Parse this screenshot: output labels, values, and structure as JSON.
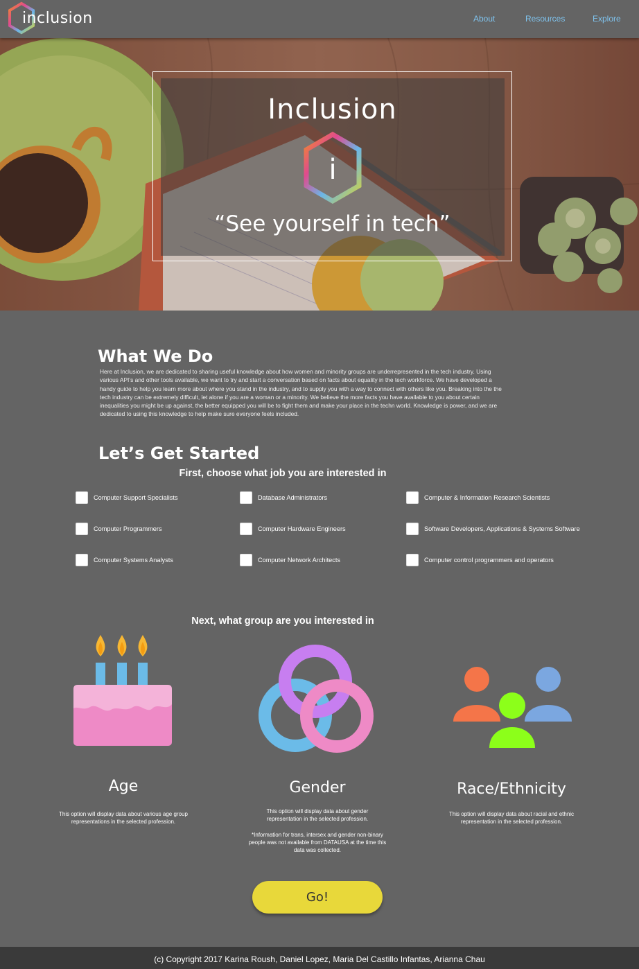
{
  "nav": {
    "logo_text": "inclusion",
    "links": [
      "About",
      "Resources",
      "Explore"
    ]
  },
  "hero": {
    "title": "Inclusion",
    "icon_letter": "i",
    "tagline": "“See yourself in tech”"
  },
  "what_we_do": {
    "heading": "What We Do",
    "body": "Here at Inclusion, we are dedicated to sharing useful knowledge about how women and minority groups are underrepresented in the tech industry.  Using various API’s and other tools available, we want to try and start a conversation based on facts about equality in the tech workforce. We have developed a handy guide to help you learn more about where you stand in the industry, and to supply you with a way to connect with others like you. Breaking into the the tech industry can be extremely difficult, let alone if you are a woman or a minority. We believe the more facts you have available to you about certain inequalities you might be up against, the better equipped you will be to fight them and make your place in the techn world. Knowledge is power, and we are dedicated to using this knowledge to help make sure everyone feels included."
  },
  "get_started": {
    "heading": "Let’s Get Started",
    "job_prompt": "First, choose what job you are interested in",
    "jobs": [
      "Computer Support Specialists",
      "Database Administrators",
      "Computer & Information Research Scientists",
      "Computer Programmers",
      "Computer Hardware Engineers",
      "Software Developers, Applications & Systems Software",
      "Computer Systems Analysts",
      "Computer Network Architects",
      "Computer control programmers and operators"
    ],
    "group_prompt": "Next, what group are you interested in"
  },
  "groups": {
    "age": {
      "title": "Age",
      "desc": "This option will display data about various age group representations in the selected profession."
    },
    "gender": {
      "title": "Gender",
      "desc": "This option will display data about gender representation in the selected profession.",
      "note": "*Information for trans, intersex and gender non-binary people was not available from DATAUSA at the time this data was collected."
    },
    "race": {
      "title": "Race/Ethnicity",
      "desc": "This option will display data about racial and ethnic representation in the selected profession."
    }
  },
  "go_label": "Go!",
  "footer": "(c) Copyright 2017 Karina Roush, Daniel Lopez, Maria Del Castillo Infantas, Arianna Chau",
  "colors": {
    "background": "#646464",
    "nav_link": "#7fc3ee",
    "go_button": "#e8d83a",
    "footer": "#3a3a3a"
  },
  "icons": [
    "hexagon-logo-icon",
    "birthday-cake-icon",
    "interlocking-rings-icon",
    "people-group-icon"
  ]
}
